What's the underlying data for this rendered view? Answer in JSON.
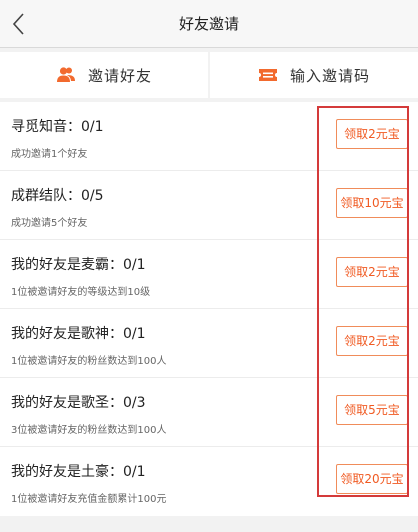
{
  "header": {
    "title": "好友邀请"
  },
  "tabs": [
    {
      "label": "邀请好友",
      "icon": "invite-friends-icon"
    },
    {
      "label": "输入邀请码",
      "icon": "ticket-icon"
    }
  ],
  "tasks": [
    {
      "title": "寻觅知音：0/1",
      "desc": "成功邀请1个好友",
      "button": "领取2元宝"
    },
    {
      "title": "成群结队：0/5",
      "desc": "成功邀请5个好友",
      "button": "领取10元宝"
    },
    {
      "title": "我的好友是麦霸：0/1",
      "desc": "1位被邀请好友的等级达到10级",
      "button": "领取2元宝"
    },
    {
      "title": "我的好友是歌神：0/1",
      "desc": "1位被邀请好友的粉丝数达到100人",
      "button": "领取2元宝"
    },
    {
      "title": "我的好友是歌圣：0/3",
      "desc": "3位被邀请好友的粉丝数达到100人",
      "button": "领取5元宝"
    },
    {
      "title": "我的好友是土豪：0/1",
      "desc": "1位被邀请好友充值金额累计100元",
      "button": "领取20元宝"
    }
  ],
  "colors": {
    "accent": "#f05a22",
    "highlight": "#d43a3a"
  }
}
